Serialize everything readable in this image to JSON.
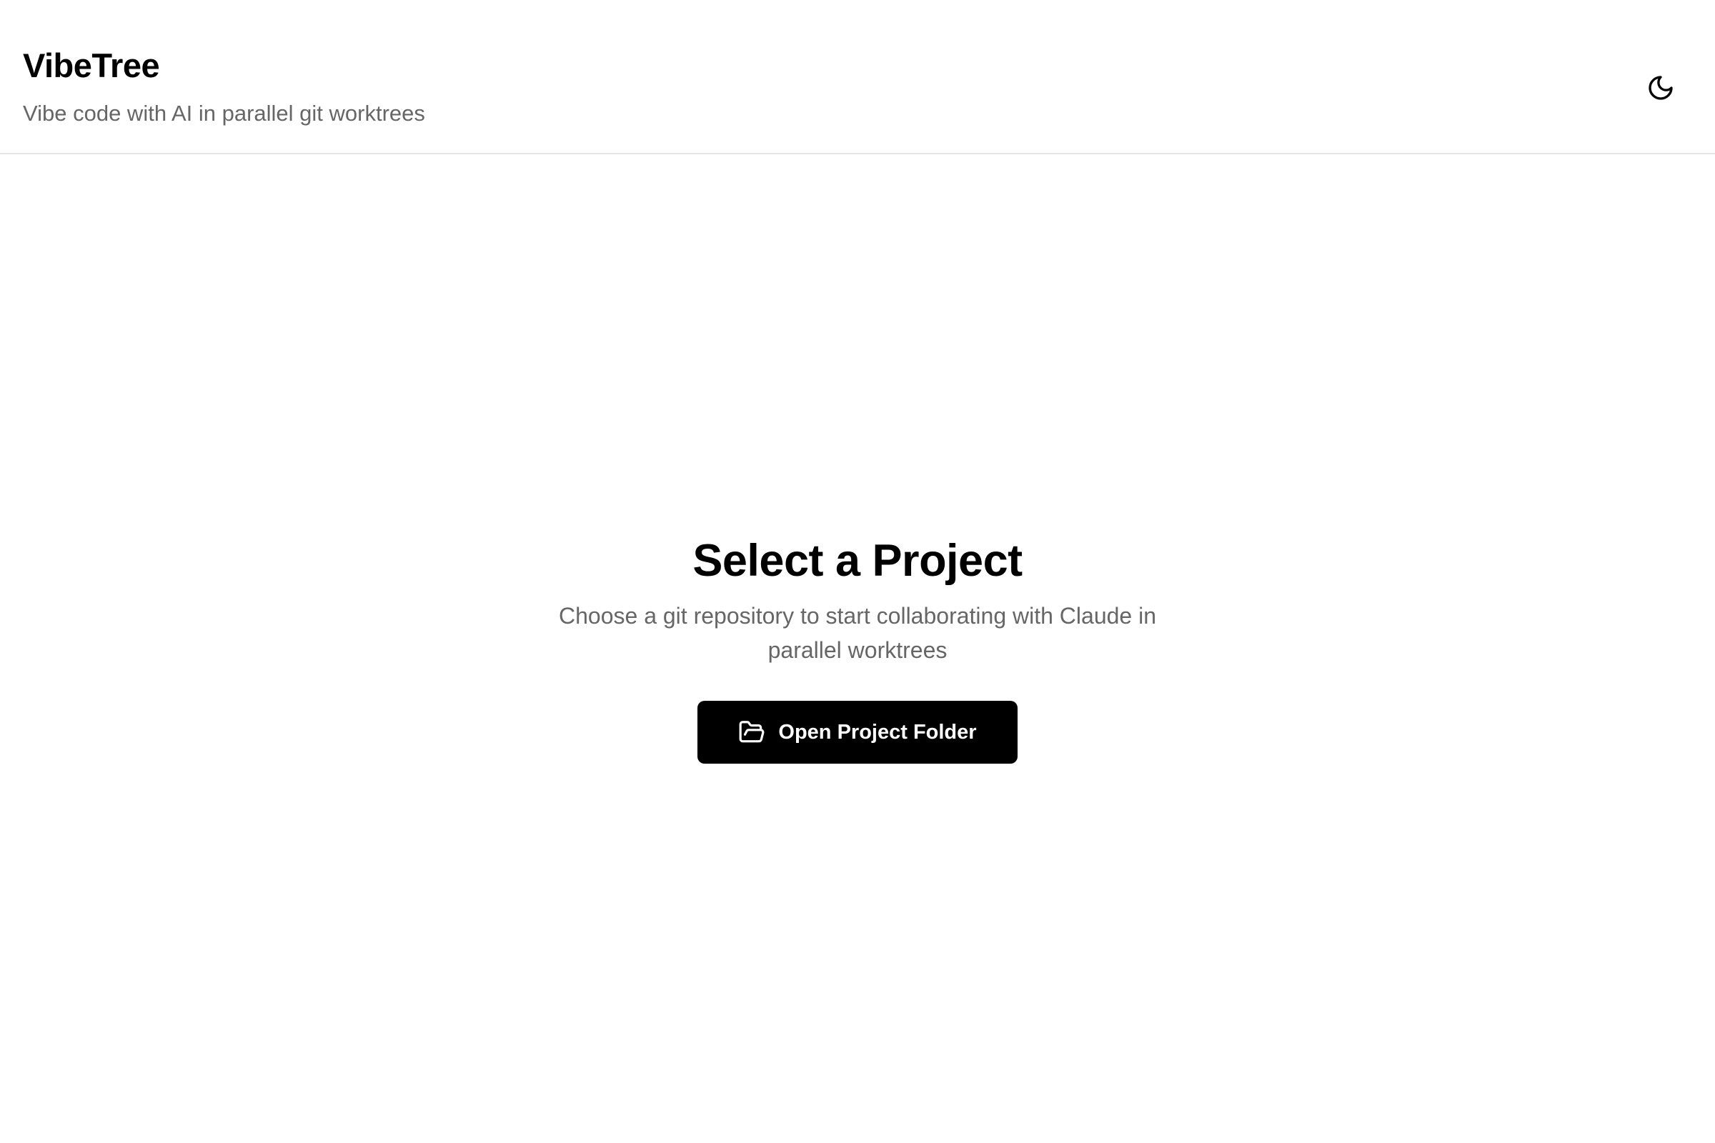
{
  "header": {
    "title": "VibeTree",
    "subtitle": "Vibe code with AI in parallel git worktrees",
    "theme_toggle_icon": "moon-icon"
  },
  "main": {
    "title": "Select a Project",
    "description": "Choose a git repository to start collaborating with Claude in parallel worktrees",
    "open_button": {
      "label": "Open Project Folder",
      "icon": "folder-open-icon"
    }
  },
  "colors": {
    "background": "#ffffff",
    "text_primary": "#000000",
    "text_muted": "#666666",
    "button_bg": "#000000",
    "button_text": "#ffffff",
    "divider": "#e4e4e7"
  }
}
